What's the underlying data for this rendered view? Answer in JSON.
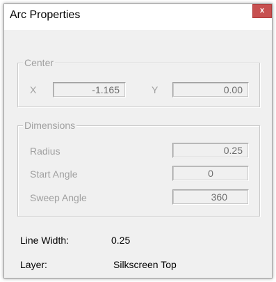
{
  "window": {
    "title": "Arc Properties",
    "close_label": "x"
  },
  "center": {
    "legend": "Center",
    "x_label": "X",
    "x_value": "-1.165",
    "y_label": "Y",
    "y_value": "0.00"
  },
  "dimensions": {
    "legend": "Dimensions",
    "radius_label": "Radius",
    "radius_value": "0.25",
    "start_angle_label": "Start Angle",
    "start_angle_value": "0",
    "sweep_angle_label": "Sweep Angle",
    "sweep_angle_value": "360"
  },
  "info": {
    "line_width_label": "Line Width:",
    "line_width_value": "0.25",
    "layer_label": "Layer:",
    "layer_value": "Silkscreen Top"
  },
  "colors": {
    "close_button": "#c75050",
    "dialog_background": "#f0f0f0",
    "disabled_text": "#a0a0a0"
  }
}
